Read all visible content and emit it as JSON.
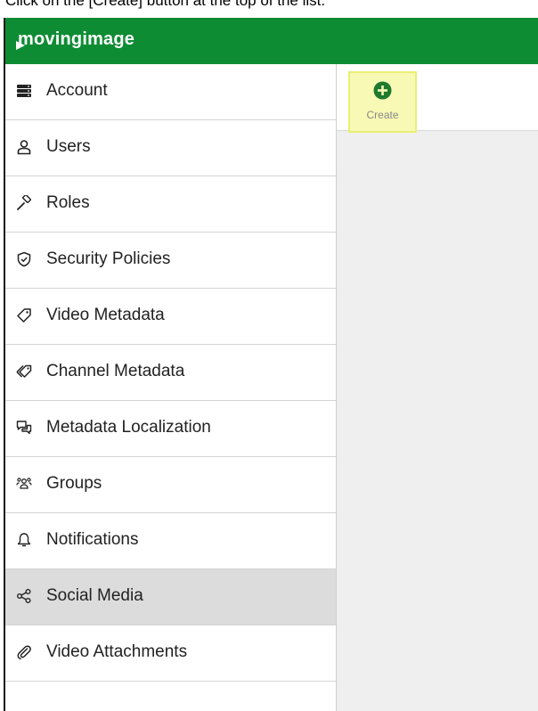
{
  "caption": "Click on the [Create] button at the top of the list.",
  "header": {
    "logo_text": "movingimage",
    "brand_color": "#0e8c34"
  },
  "sidebar": {
    "items": [
      {
        "label": "Account",
        "icon": "server-icon"
      },
      {
        "label": "Users",
        "icon": "user-icon"
      },
      {
        "label": "Roles",
        "icon": "gavel-icon"
      },
      {
        "label": "Security Policies",
        "icon": "shield-check-icon"
      },
      {
        "label": "Video Metadata",
        "icon": "tag-icon"
      },
      {
        "label": "Channel Metadata",
        "icon": "tags-icon"
      },
      {
        "label": "Metadata Localization",
        "icon": "chat-bubbles-icon"
      },
      {
        "label": "Groups",
        "icon": "users-group-icon"
      },
      {
        "label": "Notifications",
        "icon": "bell-icon"
      },
      {
        "label": "Social Media",
        "icon": "share-icon",
        "active": true
      },
      {
        "label": "Video Attachments",
        "icon": "paperclip-icon"
      }
    ]
  },
  "toolbar": {
    "create_label": "Create",
    "create_icon": "plus-circle-icon"
  },
  "colors": {
    "active_item": "#dcdcdc",
    "highlight": "#f7f9b5",
    "content_bg": "#efefef"
  }
}
